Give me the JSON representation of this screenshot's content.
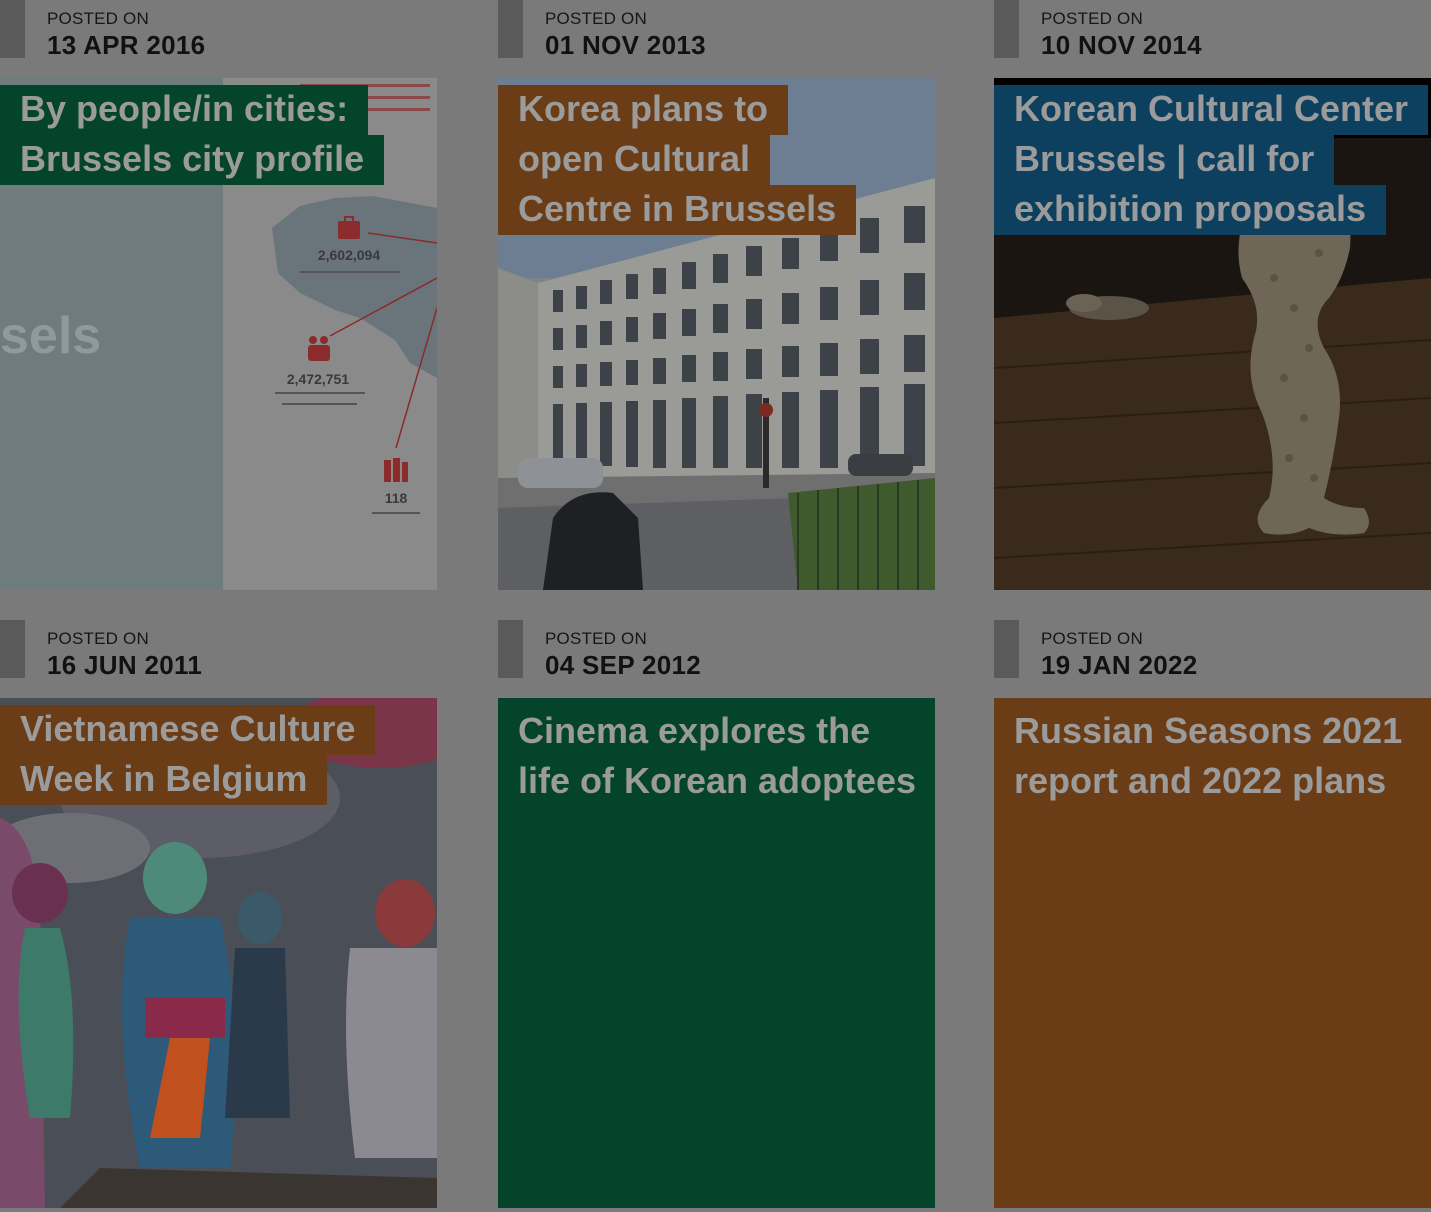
{
  "colors": {
    "overlay_gray": "#7a7a7a",
    "green": "#03442a",
    "brown": "#6b3d17",
    "blue": "#0d3f5e"
  },
  "posts": [
    {
      "posted_label": "POSTED ON",
      "date": "13 APR 2016",
      "title": "By people/in cities: Brussels city profile",
      "title_color": "green",
      "thumbnail": {
        "type": "infographic",
        "brand_text": "sels",
        "stats": [
          "2,602,094",
          "2,472,751",
          "118"
        ]
      }
    },
    {
      "posted_label": "POSTED ON",
      "date": "01 NOV 2013",
      "title": "Korea plans to open Cultural Centre in Brussels",
      "title_color": "brown",
      "thumbnail": {
        "type": "photo",
        "subject": "white office building on street corner"
      }
    },
    {
      "posted_label": "POSTED ON",
      "date": "10 NOV 2014",
      "title": "Korean Cultural Center Brussels | call for exhibition proposals",
      "title_color": "blue",
      "thumbnail": {
        "type": "photo",
        "subject": "textured sculpture on wooden floor"
      }
    },
    {
      "posted_label": "POSTED ON",
      "date": "16 JUN 2011",
      "title": "Vietnamese Culture Week in Belgium",
      "title_color": "brown",
      "thumbnail": {
        "type": "photo",
        "subject": "market scene with women in colorful traditional dress"
      }
    },
    {
      "posted_label": "POSTED ON",
      "date": "04 SEP 2012",
      "title": "Cinema explores the life of Korean adoptees",
      "title_color": "green",
      "thumbnail": {
        "type": "solid"
      }
    },
    {
      "posted_label": "POSTED ON",
      "date": "19 JAN 2022",
      "title": "Russian Seasons 2021 report and 2022 plans",
      "title_color": "brown",
      "thumbnail": {
        "type": "solid"
      }
    }
  ]
}
